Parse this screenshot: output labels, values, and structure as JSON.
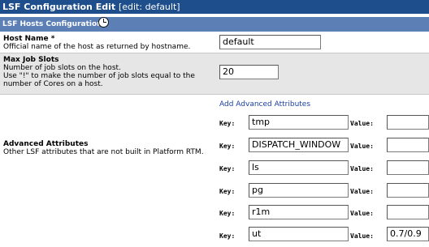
{
  "header": {
    "title": "LSF Configuration Edit",
    "subtitle": "[edit: default]"
  },
  "section": {
    "title": "LSF Hosts Configuration",
    "icon": "clock-icon"
  },
  "fields": {
    "host_name": {
      "label": "Host Name *",
      "description": "Official name of the host as returned by hostname.",
      "value": "default"
    },
    "max_job_slots": {
      "label": "Max Job Slots",
      "description_1": "Number of job slots on the host.",
      "description_2": "Use \"!\" to make the number of job slots equal to the",
      "description_3": "number of Cores on a host.",
      "value": "20"
    },
    "advanced": {
      "label": "Advanced Attributes",
      "description": "Other LSF attributes that are not built in Platform RTM.",
      "add_link": "Add Advanced Attributes",
      "key_label": "Key:",
      "value_label": "Value:",
      "rows": [
        {
          "key": "tmp",
          "value": ""
        },
        {
          "key": "DISPATCH_WINDOW",
          "value": ""
        },
        {
          "key": "ls",
          "value": ""
        },
        {
          "key": "pg",
          "value": ""
        },
        {
          "key": "r1m",
          "value": ""
        },
        {
          "key": "ut",
          "value": "0.7/0.9"
        }
      ]
    }
  }
}
